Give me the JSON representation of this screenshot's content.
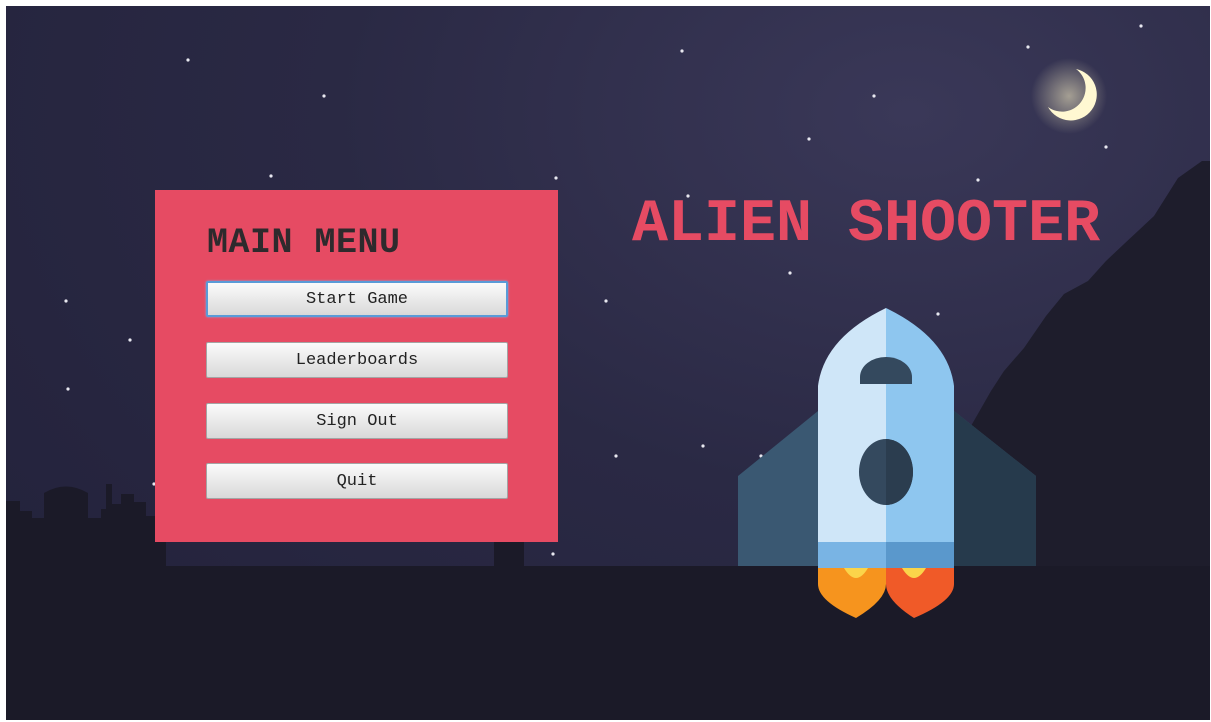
{
  "game": {
    "title": "ALIEN SHOOTER"
  },
  "main_menu": {
    "heading": "MAIN MENU",
    "buttons": [
      {
        "label": "Start Game",
        "focused": true
      },
      {
        "label": "Leaderboards",
        "focused": false
      },
      {
        "label": "Sign Out",
        "focused": false
      },
      {
        "label": "Quit",
        "focused": false
      }
    ]
  },
  "scene": {
    "background_color": "#2a2944",
    "ground_color": "#1b1a28",
    "accent_color": "#e64b63",
    "moon_color": "#fff8d2",
    "icons": [
      "crescent-moon-icon",
      "rocket-icon"
    ]
  }
}
